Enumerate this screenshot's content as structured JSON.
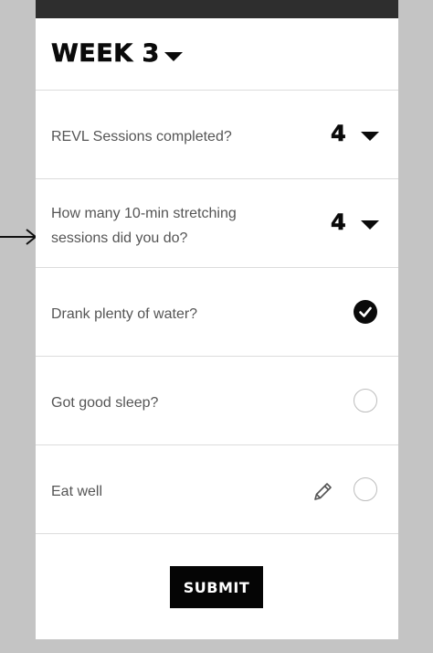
{
  "header": {
    "week_title": "WEEK 3"
  },
  "rows": [
    {
      "label": "REVL Sessions completed?",
      "value": "4"
    },
    {
      "label_line1": "How many 10-min stretching",
      "label_line2": "sessions did you do?",
      "value": "4"
    },
    {
      "label": "Drank plenty of water?",
      "checked": true
    },
    {
      "label": "Got good sleep?",
      "checked": false
    },
    {
      "label": "Eat well",
      "checked": false
    }
  ],
  "submit": {
    "label": "SUBMIT"
  },
  "icons": {
    "week_dropdown": "caret-down-icon",
    "stepper_dropdown": "caret-down-icon",
    "checked": "check-circle-icon",
    "unchecked": "empty-circle-icon",
    "edit": "pencil-icon",
    "pointer": "arrow-right-icon"
  },
  "colors": {
    "background": "#c4c4c4",
    "card": "#ffffff",
    "topbar": "#2e2e2e",
    "text_primary": "#0a0a0a",
    "text_secondary": "#555555",
    "divider": "#dcdcdc",
    "button": "#050505"
  }
}
